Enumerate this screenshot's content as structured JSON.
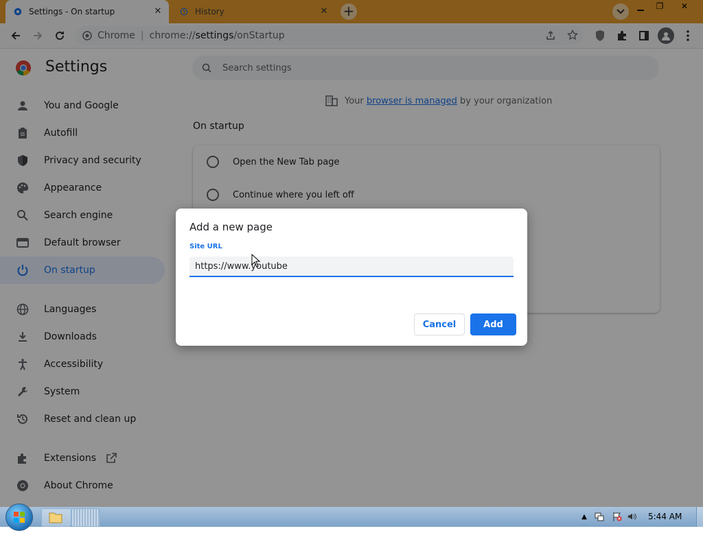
{
  "browser": {
    "tabs": [
      {
        "title": "Settings - On startup",
        "icon": "settings-gear-icon",
        "active": true
      },
      {
        "title": "History",
        "icon": "history-icon",
        "active": false
      }
    ],
    "new_tab": "+",
    "omnibox": {
      "site_label": "Chrome",
      "url_prefix": "chrome://",
      "url_host": "settings",
      "url_path": "/onStartup"
    }
  },
  "settings": {
    "title": "Settings",
    "search_placeholder": "Search settings",
    "nav": [
      {
        "label": "You and Google",
        "icon": "person-icon"
      },
      {
        "label": "Autofill",
        "icon": "clipboard-icon"
      },
      {
        "label": "Privacy and security",
        "icon": "shield-icon"
      },
      {
        "label": "Appearance",
        "icon": "palette-icon"
      },
      {
        "label": "Search engine",
        "icon": "search-icon"
      },
      {
        "label": "Default browser",
        "icon": "browser-window-icon"
      },
      {
        "label": "On startup",
        "icon": "power-icon",
        "active": true
      },
      {
        "label": "Languages",
        "icon": "globe-icon"
      },
      {
        "label": "Downloads",
        "icon": "download-icon"
      },
      {
        "label": "Accessibility",
        "icon": "accessibility-icon"
      },
      {
        "label": "System",
        "icon": "wrench-icon"
      },
      {
        "label": "Reset and clean up",
        "icon": "history-icon"
      },
      {
        "label": "Extensions",
        "icon": "puzzle-icon"
      },
      {
        "label": "About Chrome",
        "icon": "chrome-icon"
      }
    ],
    "managed": {
      "prefix": "Your",
      "link": "browser is managed",
      "suffix": "by your organization"
    },
    "section_title": "On startup",
    "options": [
      "Open the New Tab page",
      "Continue where you left off"
    ]
  },
  "dialog": {
    "title": "Add a new page",
    "field_label": "Site URL",
    "field_value": "https://www.youtube",
    "cancel": "Cancel",
    "add": "Add"
  },
  "taskbar": {
    "clock": "5:44 AM"
  },
  "colors": {
    "accent": "#1a73e8",
    "title_bar": "#e69c2e"
  }
}
